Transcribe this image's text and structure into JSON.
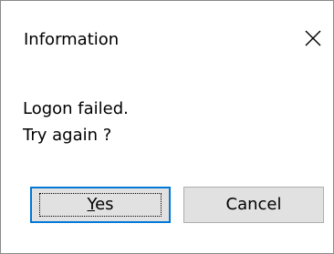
{
  "window": {
    "title": "Information"
  },
  "message": {
    "line1": "Logon failed.",
    "line2": "Try again ?"
  },
  "buttons": {
    "yes": {
      "label_first": "Y",
      "label_rest": "es"
    },
    "cancel": {
      "label": "Cancel"
    }
  },
  "icons": {
    "close": "close-icon"
  },
  "colors": {
    "focus_border": "#0078d7",
    "button_bg": "#e1e1e1",
    "button_border": "#adadad"
  }
}
